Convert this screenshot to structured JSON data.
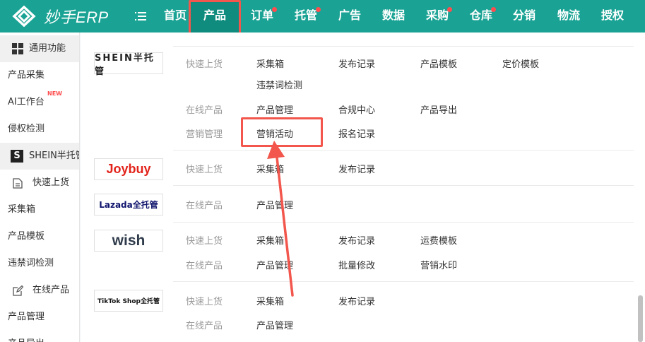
{
  "header": {
    "logo_text": "妙手ERP",
    "nav": [
      {
        "label": "首页",
        "dot": false
      },
      {
        "label": "产品",
        "dot": false,
        "active": true
      },
      {
        "label": "订单",
        "dot": true
      },
      {
        "label": "托管",
        "dot": true
      },
      {
        "label": "广告",
        "dot": false
      },
      {
        "label": "数据",
        "dot": false
      },
      {
        "label": "采购",
        "dot": true
      },
      {
        "label": "仓库",
        "dot": true
      },
      {
        "label": "分销",
        "dot": false
      },
      {
        "label": "物流",
        "dot": false
      },
      {
        "label": "授权",
        "dot": false
      }
    ]
  },
  "sidebar": {
    "items": [
      {
        "label": "通用功能"
      },
      {
        "label": "产品采集"
      },
      {
        "label": "AI工作台",
        "badge": "NEW"
      },
      {
        "label": "侵权检测"
      },
      {
        "label": "SHEIN半托管"
      },
      {
        "label": "快速上货"
      },
      {
        "label": "采集箱"
      },
      {
        "label": "产品模板"
      },
      {
        "label": "违禁词检测"
      },
      {
        "label": "在线产品"
      },
      {
        "label": "产品管理"
      },
      {
        "label": "产品导出"
      }
    ]
  },
  "panel": {
    "brands": [
      {
        "logo": "SHEIN半托管",
        "color": "#222222"
      },
      {
        "logo": "Joybuy",
        "color": "#e2231a"
      },
      {
        "logo": "Lazada全托管",
        "color": "#0f146d"
      },
      {
        "logo": "wish",
        "color": "#2f3b4b"
      },
      {
        "logo": "TikTok Shop全托管",
        "color": "#111111"
      }
    ],
    "sections": {
      "shein_quick": {
        "category": "快速上货",
        "links": [
          "采集箱",
          "发布记录",
          "产品模板",
          "定价模板",
          "违禁词检测"
        ]
      },
      "shein_online": {
        "category": "在线产品",
        "links": [
          "产品管理",
          "合规中心",
          "产品导出"
        ]
      },
      "shein_marketing": {
        "category": "营销管理",
        "links": [
          "营销活动",
          "报名记录"
        ]
      },
      "joybuy_quick": {
        "category": "快速上货",
        "links": [
          "采集箱",
          "发布记录"
        ]
      },
      "lazada_online": {
        "category": "在线产品",
        "links": [
          "产品管理"
        ]
      },
      "wish_quick": {
        "category": "快速上货",
        "links": [
          "采集箱",
          "发布记录",
          "运费模板"
        ]
      },
      "wish_online": {
        "category": "在线产品",
        "links": [
          "产品管理",
          "批量修改",
          "营销水印"
        ]
      },
      "tiktok_quick": {
        "category": "快速上货",
        "links": [
          "采集箱",
          "发布记录"
        ]
      },
      "tiktok_online": {
        "category": "在线产品",
        "links": [
          "产品管理"
        ]
      }
    }
  },
  "colors": {
    "brand_teal": "#1aa394",
    "active_tab": "#0f8c7e",
    "annotation_red": "#f2564c"
  }
}
